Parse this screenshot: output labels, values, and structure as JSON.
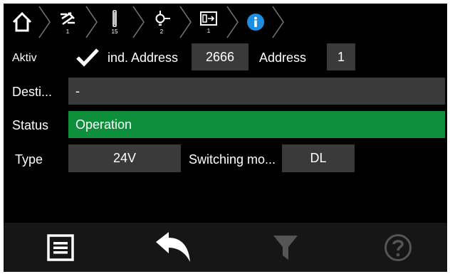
{
  "breadcrumb": [
    {
      "icon": "home-icon",
      "count": ""
    },
    {
      "icon": "bus-disconnect-icon",
      "count": "1"
    },
    {
      "icon": "line-icon",
      "count": "15"
    },
    {
      "icon": "lamp-icon",
      "count": "2"
    },
    {
      "icon": "exit-sign-icon",
      "count": "1"
    },
    {
      "icon": "info-icon",
      "count": ""
    }
  ],
  "row1": {
    "label": "Aktiv",
    "ind_address_label": "ind. Address",
    "ind_address_value": "2666",
    "address_label": "Address",
    "address_value": "1"
  },
  "row2": {
    "label": "Desti...",
    "value": "-"
  },
  "row3": {
    "label": "Status",
    "value": "Operation"
  },
  "row4": {
    "label": "Type",
    "type_value": "24V",
    "mode_label": "Switching mo...",
    "mode_value": "DL"
  },
  "toolbar": [
    {
      "icon": "list-icon"
    },
    {
      "icon": "back-arrow-icon"
    },
    {
      "icon": "filter-icon"
    },
    {
      "icon": "help-icon"
    }
  ],
  "colors": {
    "status_ok": "#0e8f3c",
    "field_bg": "#3a3a3a",
    "info_accent": "#1e8fe0",
    "toolbar_disabled": "#555555"
  }
}
